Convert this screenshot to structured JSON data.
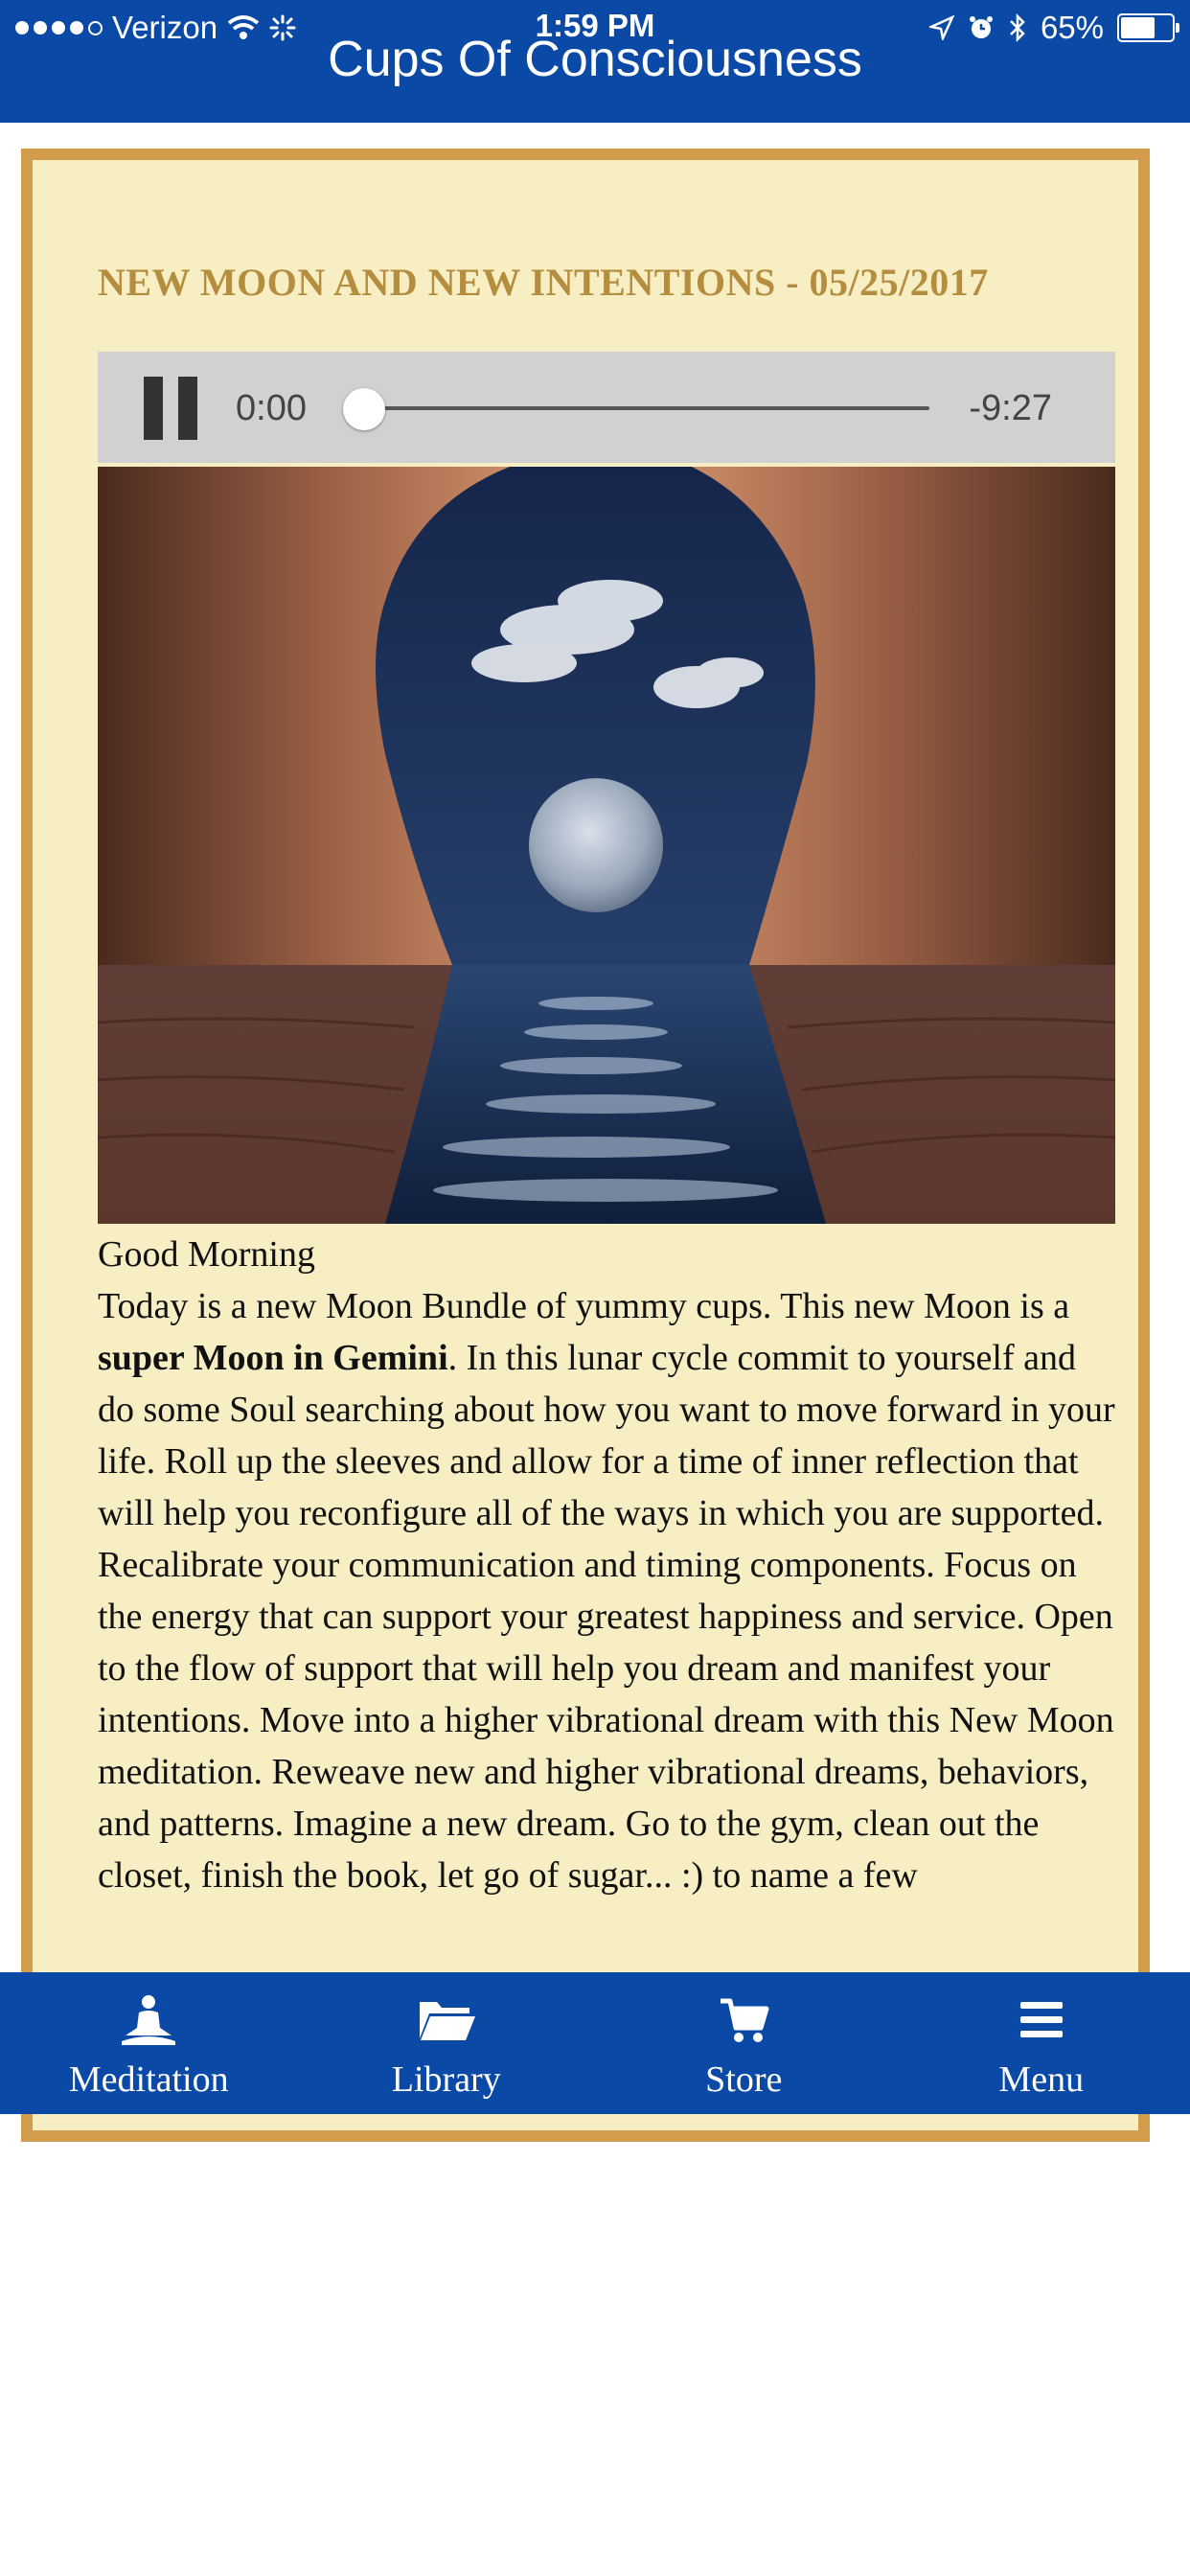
{
  "status_bar": {
    "carrier": "Verizon",
    "time": "1:59 PM",
    "battery": "65%"
  },
  "header": {
    "title": "Cups Of Consciousness"
  },
  "post": {
    "title": "NEW MOON AND NEW INTENTIONS - 05/25/2017",
    "player": {
      "current_time": "0:00",
      "remaining_time": "-9:27",
      "progress": 0
    },
    "greeting": "Good Morning",
    "para_start": "Today is a new Moon Bundle of yummy cups. This new Moon is a ",
    "para_bold": "super Moon in Gemini",
    "para_rest": ". In this lunar cycle commit to yourself and do some Soul searching about how you want to move forward in your life. Roll up the sleeves and allow for a time of inner reflection that will help you reconfigure all of the ways in which you are supported. Recalibrate your communication and timing components. Focus on the energy that can support your greatest happiness and service. Open to the flow of support that will help you dream and manifest your intentions. Move into a higher vibrational dream with this New Moon meditation. Reweave new and higher vibrational dreams, behaviors, and patterns. Imagine a new dream. Go to the gym, clean out the closet, finish the book, let go of sugar... :) to name a few"
  },
  "tabs": [
    {
      "label": "Meditation",
      "icon": "meditation-icon"
    },
    {
      "label": "Library",
      "icon": "folder-icon"
    },
    {
      "label": "Store",
      "icon": "cart-icon"
    },
    {
      "label": "Menu",
      "icon": "menu-icon"
    }
  ],
  "colors": {
    "brand_blue": "#0a4aa6",
    "card_bg": "#f7eec4",
    "card_border": "#d29c4c",
    "title_gold": "#b58d3f"
  }
}
